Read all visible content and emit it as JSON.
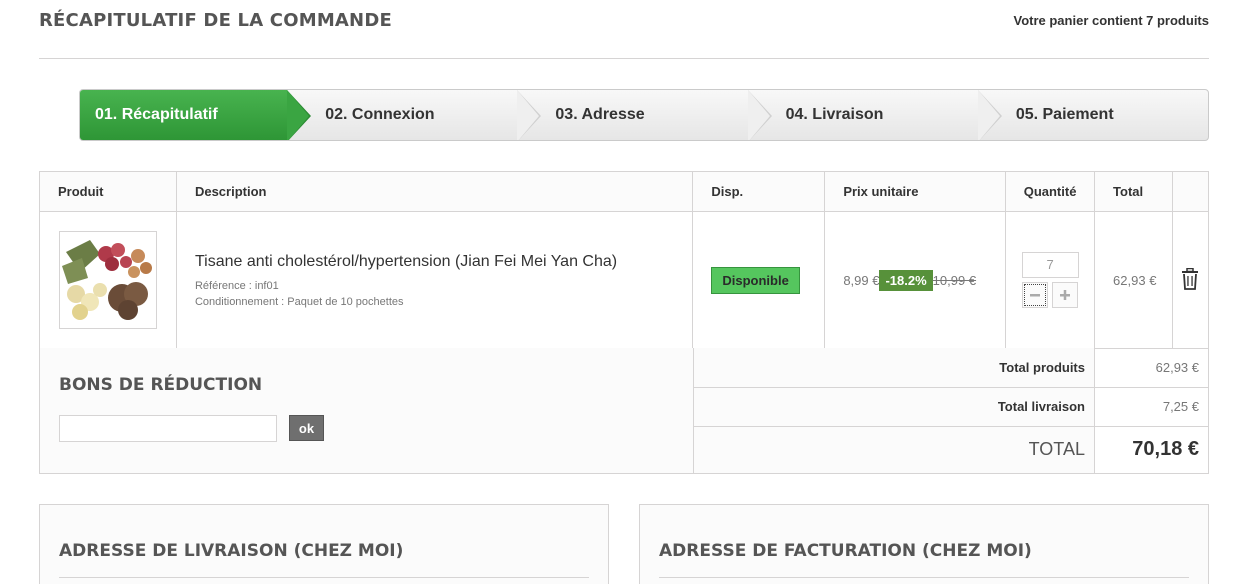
{
  "header": {
    "title": "RÉCAPITULATIF DE LA COMMANDE",
    "cart_count": "Votre panier contient 7 produits"
  },
  "steps": [
    {
      "label": "01. Récapitulatif",
      "active": true
    },
    {
      "label": "02. Connexion",
      "active": false
    },
    {
      "label": "03. Adresse",
      "active": false
    },
    {
      "label": "04. Livraison",
      "active": false
    },
    {
      "label": "05. Paiement",
      "active": false
    }
  ],
  "table": {
    "headers": {
      "product": "Produit",
      "description": "Description",
      "availability": "Disp.",
      "unit_price": "Prix unitaire",
      "quantity": "Quantité",
      "total": "Total"
    },
    "row": {
      "name": "Tisane anti cholestérol/hypertension (Jian Fei Mei Yan Cha)",
      "reference": "Référence : inf01",
      "packaging": "Conditionnement : Paquet de 10 pochettes",
      "availability": "Disponible",
      "price": "8,99 €",
      "reduction": "-18.2%",
      "old_price": "10,99 €",
      "quantity": "7",
      "total": "62,93 €",
      "delete_icon": "trash-icon"
    }
  },
  "voucher": {
    "title": "BONS DE RÉDUCTION",
    "input_value": "",
    "button_label": "ok"
  },
  "totals": {
    "products_label": "Total produits",
    "products_value": "62,93 €",
    "shipping_label": "Total livraison",
    "shipping_value": "7,25 €",
    "grand_label": "TOTAL",
    "grand_value": "70,18 €"
  },
  "addresses": {
    "delivery_title": "ADRESSE DE LIVRAISON (CHEZ MOI)",
    "billing_title": "ADRESSE DE FACTURATION (CHEZ MOI)"
  },
  "colors": {
    "active_step": "#3aa542",
    "available_badge": "#55c65e",
    "reduction_badge": "#57913a"
  }
}
